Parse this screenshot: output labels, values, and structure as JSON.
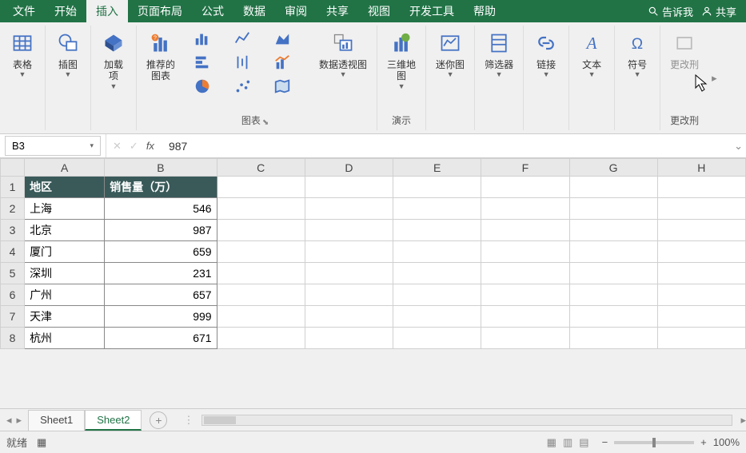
{
  "menu": {
    "tabs": [
      "文件",
      "开始",
      "插入",
      "页面布局",
      "公式",
      "数据",
      "审阅",
      "共享",
      "视图",
      "开发工具",
      "帮助"
    ],
    "active_index": 2,
    "tellme": "告诉我",
    "share": "共享"
  },
  "ribbon": {
    "groups": {
      "tables": {
        "btn": "表格",
        "label": ""
      },
      "illustrations": {
        "btn": "插图",
        "label": ""
      },
      "addins": {
        "btn": "加载\n项",
        "label": ""
      },
      "charts": {
        "recommended": "推荐的\n图表",
        "pivot": "数据透视图",
        "label": "图表"
      },
      "tours": {
        "btn": "三维地\n图",
        "label": "演示"
      },
      "sparklines": {
        "btn": "迷你图",
        "label": ""
      },
      "filters": {
        "btn": "筛选器",
        "label": ""
      },
      "links": {
        "btn": "链接",
        "label": ""
      },
      "text": {
        "btn": "文本",
        "label": ""
      },
      "symbols": {
        "btn": "符号",
        "label": ""
      },
      "overflow": {
        "btn": "更改刑",
        "label": "更改刑"
      }
    }
  },
  "formula_bar": {
    "name_box": "B3",
    "formula": "987"
  },
  "grid": {
    "columns": [
      "A",
      "B",
      "C",
      "D",
      "E",
      "F",
      "G",
      "H"
    ],
    "header": {
      "A": "地区",
      "B": "销售量（万）"
    },
    "rows": [
      {
        "A": "上海",
        "B": "546"
      },
      {
        "A": "北京",
        "B": "987"
      },
      {
        "A": "厦门",
        "B": "659"
      },
      {
        "A": "深圳",
        "B": "231"
      },
      {
        "A": "广州",
        "B": "657"
      },
      {
        "A": "天津",
        "B": "999"
      },
      {
        "A": "杭州",
        "B": "671"
      }
    ]
  },
  "chart_data": {
    "type": "table",
    "title": "销售量（万）",
    "categories": [
      "上海",
      "北京",
      "厦门",
      "深圳",
      "广州",
      "天津",
      "杭州"
    ],
    "values": [
      546,
      987,
      659,
      231,
      657,
      999,
      671
    ],
    "xlabel": "地区",
    "ylabel": "销售量（万）"
  },
  "sheets": {
    "tabs": [
      "Sheet1",
      "Sheet2"
    ],
    "active_index": 1
  },
  "status": {
    "ready": "就绪",
    "zoom": "100%"
  }
}
